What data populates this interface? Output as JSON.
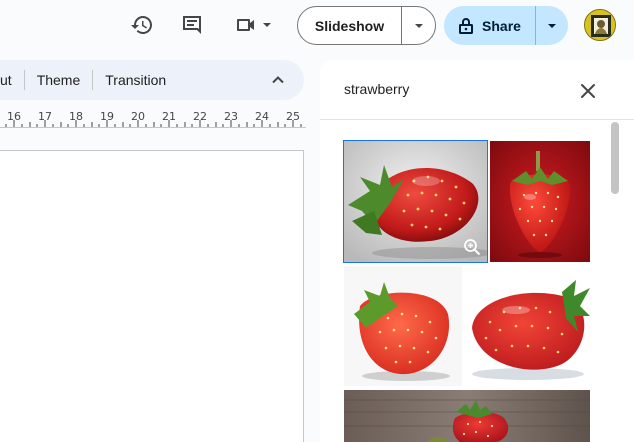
{
  "toolbar": {
    "history_icon": "history-icon",
    "comments_icon": "comments-icon",
    "meet_icon": "video-camera-icon",
    "slideshow_label": "Slideshow",
    "share_label": "Share",
    "share_icon": "lock-icon"
  },
  "menubar": {
    "items": [
      {
        "label": "ut"
      },
      {
        "label": "Theme"
      },
      {
        "label": "Transition"
      }
    ]
  },
  "ruler": {
    "numbers": [
      "16",
      "17",
      "18",
      "19",
      "20",
      "21",
      "22",
      "23",
      "24",
      "25"
    ]
  },
  "search_panel": {
    "query": "strawberry",
    "results": [
      {
        "id": "result-1",
        "subject": "strawberry with leaves on gray background",
        "selected": true
      },
      {
        "id": "result-2",
        "subject": "strawberry on red background",
        "selected": false
      },
      {
        "id": "result-3",
        "subject": "strawberry on white background",
        "selected": false
      },
      {
        "id": "result-4",
        "subject": "strawberry lying on white",
        "selected": false
      },
      {
        "id": "result-5",
        "subject": "strawberry on wooden table",
        "selected": false
      }
    ]
  },
  "colors": {
    "share_bg": "#c2e7ff",
    "menubar_bg": "#edf2fa",
    "selection": "#1a73e8"
  }
}
